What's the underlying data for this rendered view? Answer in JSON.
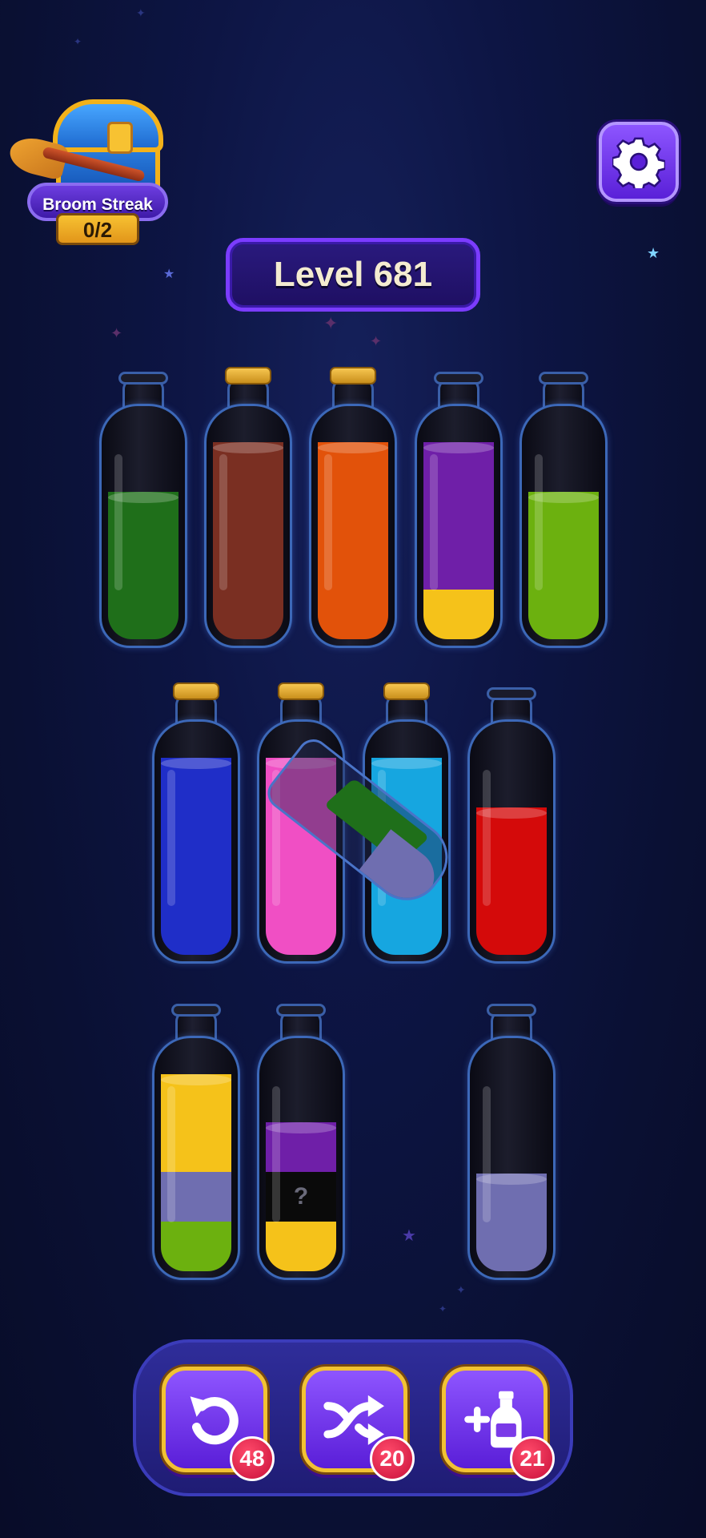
{
  "header": {
    "streak_title": "Broom Streak",
    "streak_count": "0/2",
    "level_label": "Level 681",
    "settings_icon": "gear-icon"
  },
  "bottles": [
    {
      "row": 1,
      "corked": false,
      "layers": [
        {
          "color": "#1f6f1a",
          "fraction": 0.65
        }
      ]
    },
    {
      "row": 1,
      "corked": true,
      "layers": [
        {
          "color": "#7a2f22",
          "fraction": 0.87
        }
      ]
    },
    {
      "row": 1,
      "corked": true,
      "layers": [
        {
          "color": "#e2520a",
          "fraction": 0.87
        }
      ]
    },
    {
      "row": 1,
      "corked": false,
      "layers": [
        {
          "color": "#f5c21a",
          "fraction": 0.22
        },
        {
          "color": "#6f1fa8",
          "fraction": 0.65
        }
      ]
    },
    {
      "row": 1,
      "corked": false,
      "layers": [
        {
          "color": "#6cb10f",
          "fraction": 0.65
        }
      ]
    },
    {
      "row": 2,
      "corked": true,
      "layers": [
        {
          "color": "#1f2ec8",
          "fraction": 0.87
        }
      ]
    },
    {
      "row": 2,
      "corked": true,
      "layers": [
        {
          "color": "#f04fc4",
          "fraction": 0.87
        }
      ]
    },
    {
      "row": 2,
      "corked": true,
      "layers": [
        {
          "color": "#16a6e0",
          "fraction": 0.87
        }
      ]
    },
    {
      "row": 2,
      "corked": false,
      "layers": [
        {
          "color": "#d40a0a",
          "fraction": 0.65
        }
      ]
    },
    {
      "row": 3,
      "corked": false,
      "layers": [
        {
          "color": "#6cb10f",
          "fraction": 0.22
        },
        {
          "color": "#6f6eb0",
          "fraction": 0.22
        },
        {
          "color": "#f5c21a",
          "fraction": 0.43
        }
      ]
    },
    {
      "row": 3,
      "corked": false,
      "layers": [
        {
          "color": "#f5c21a",
          "fraction": 0.22
        },
        {
          "color": "#0a0a0a",
          "fraction": 0.22,
          "label": "?"
        },
        {
          "color": "#6f1fa8",
          "fraction": 0.22
        }
      ]
    },
    {
      "row": 3,
      "corked": false,
      "layers": [
        {
          "color": "#6f6eb0",
          "fraction": 0.43
        }
      ]
    }
  ],
  "pouring_bottle": {
    "layers": [
      {
        "color": "#6f6eb0",
        "fraction": 0.25
      },
      {
        "color": "#1f6f1a",
        "fraction": 0.25
      }
    ]
  },
  "toolbar": {
    "undo": {
      "icon": "undo-icon",
      "count": "48"
    },
    "shuffle": {
      "icon": "shuffle-icon",
      "count": "20"
    },
    "add_bottle": {
      "icon": "add-bottle-icon",
      "count": "21"
    }
  }
}
